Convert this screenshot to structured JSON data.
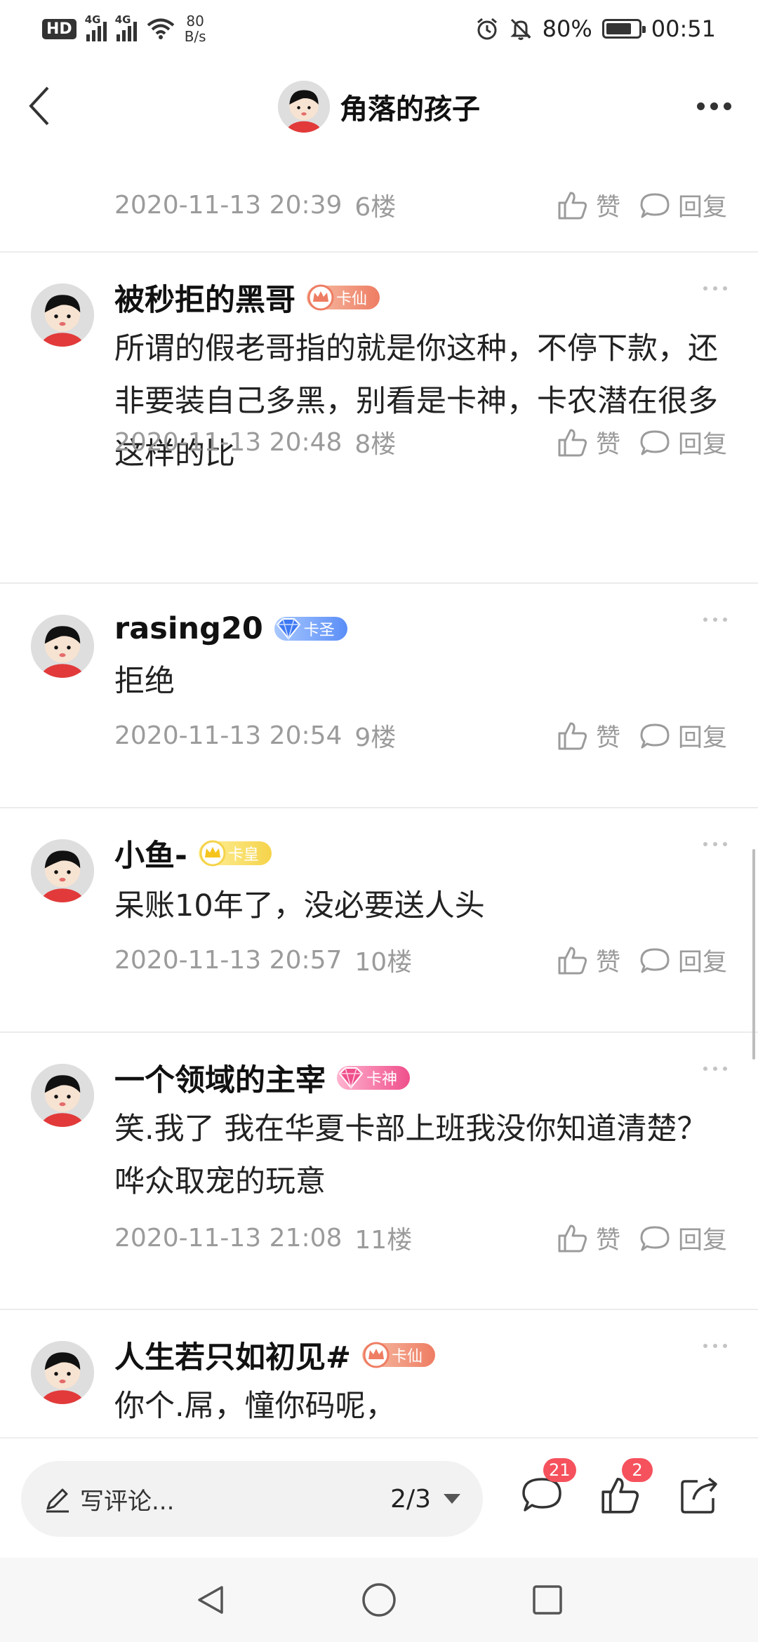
{
  "status_bar": {
    "hd": "HD",
    "network_1": "4G",
    "network_2": "4G",
    "speed_value": "80",
    "speed_unit": "B/s",
    "battery": "80%",
    "time": "00:51",
    "icons": [
      "alarm-icon",
      "mute-icon",
      "battery-icon"
    ]
  },
  "header": {
    "title": "角落的孩子",
    "icons": [
      "back-icon",
      "more-icon"
    ]
  },
  "first_meta": {
    "time": "2020-11-13 20:39",
    "floor": "6楼",
    "like_label": "赞",
    "reply_label": "回复"
  },
  "comments": [
    {
      "user": "被秒拒的黑哥",
      "badge": "卡仙",
      "badge_type": "xian",
      "text": "所谓的假老哥指的就是你这种，不停下款，还非要装自己多黑，别看是卡神，卡农潜在很多这样的比",
      "time": "2020-11-13 20:48",
      "floor": "8楼",
      "like_label": "赞",
      "reply_label": "回复"
    },
    {
      "user": "rasing20",
      "badge": "卡圣",
      "badge_type": "sheng",
      "text": "拒绝",
      "time": "2020-11-13 20:54",
      "floor": "9楼",
      "like_label": "赞",
      "reply_label": "回复"
    },
    {
      "user": "小鱼-",
      "badge": "卡皇",
      "badge_type": "huang",
      "text": "呆账10年了，没必要送人头",
      "time": "2020-11-13 20:57",
      "floor": "10楼",
      "like_label": "赞",
      "reply_label": "回复"
    },
    {
      "user": "一个领域的主宰",
      "badge": "卡神",
      "badge_type": "shen",
      "text": "笑.我了 我在华夏卡部上班我没你知道清楚？哗众取宠的玩意",
      "time": "2020-11-13 21:08",
      "floor": "11楼",
      "like_label": "赞",
      "reply_label": "回复"
    },
    {
      "user": "人生若只如初见#",
      "badge": "卡仙",
      "badge_type": "xian",
      "text": "你个.屌，憧你码呢，",
      "time": "",
      "floor": "",
      "like_label": "",
      "reply_label": ""
    }
  ],
  "bottom_bar": {
    "write_placeholder": "写评论...",
    "page_indicator": "2/3",
    "comment_count": "21",
    "like_count": "2",
    "icons": [
      "pen-icon",
      "chevron-down-icon",
      "comment-icon",
      "thumbs-up-icon",
      "share-icon"
    ]
  },
  "nav_bar": {
    "icons": [
      "nav-back-icon",
      "nav-home-icon",
      "nav-recent-icon"
    ]
  },
  "colors": {
    "meta_gray": "#9b9b9b",
    "badge_red": "#f5525d",
    "divider": "#ececec"
  }
}
